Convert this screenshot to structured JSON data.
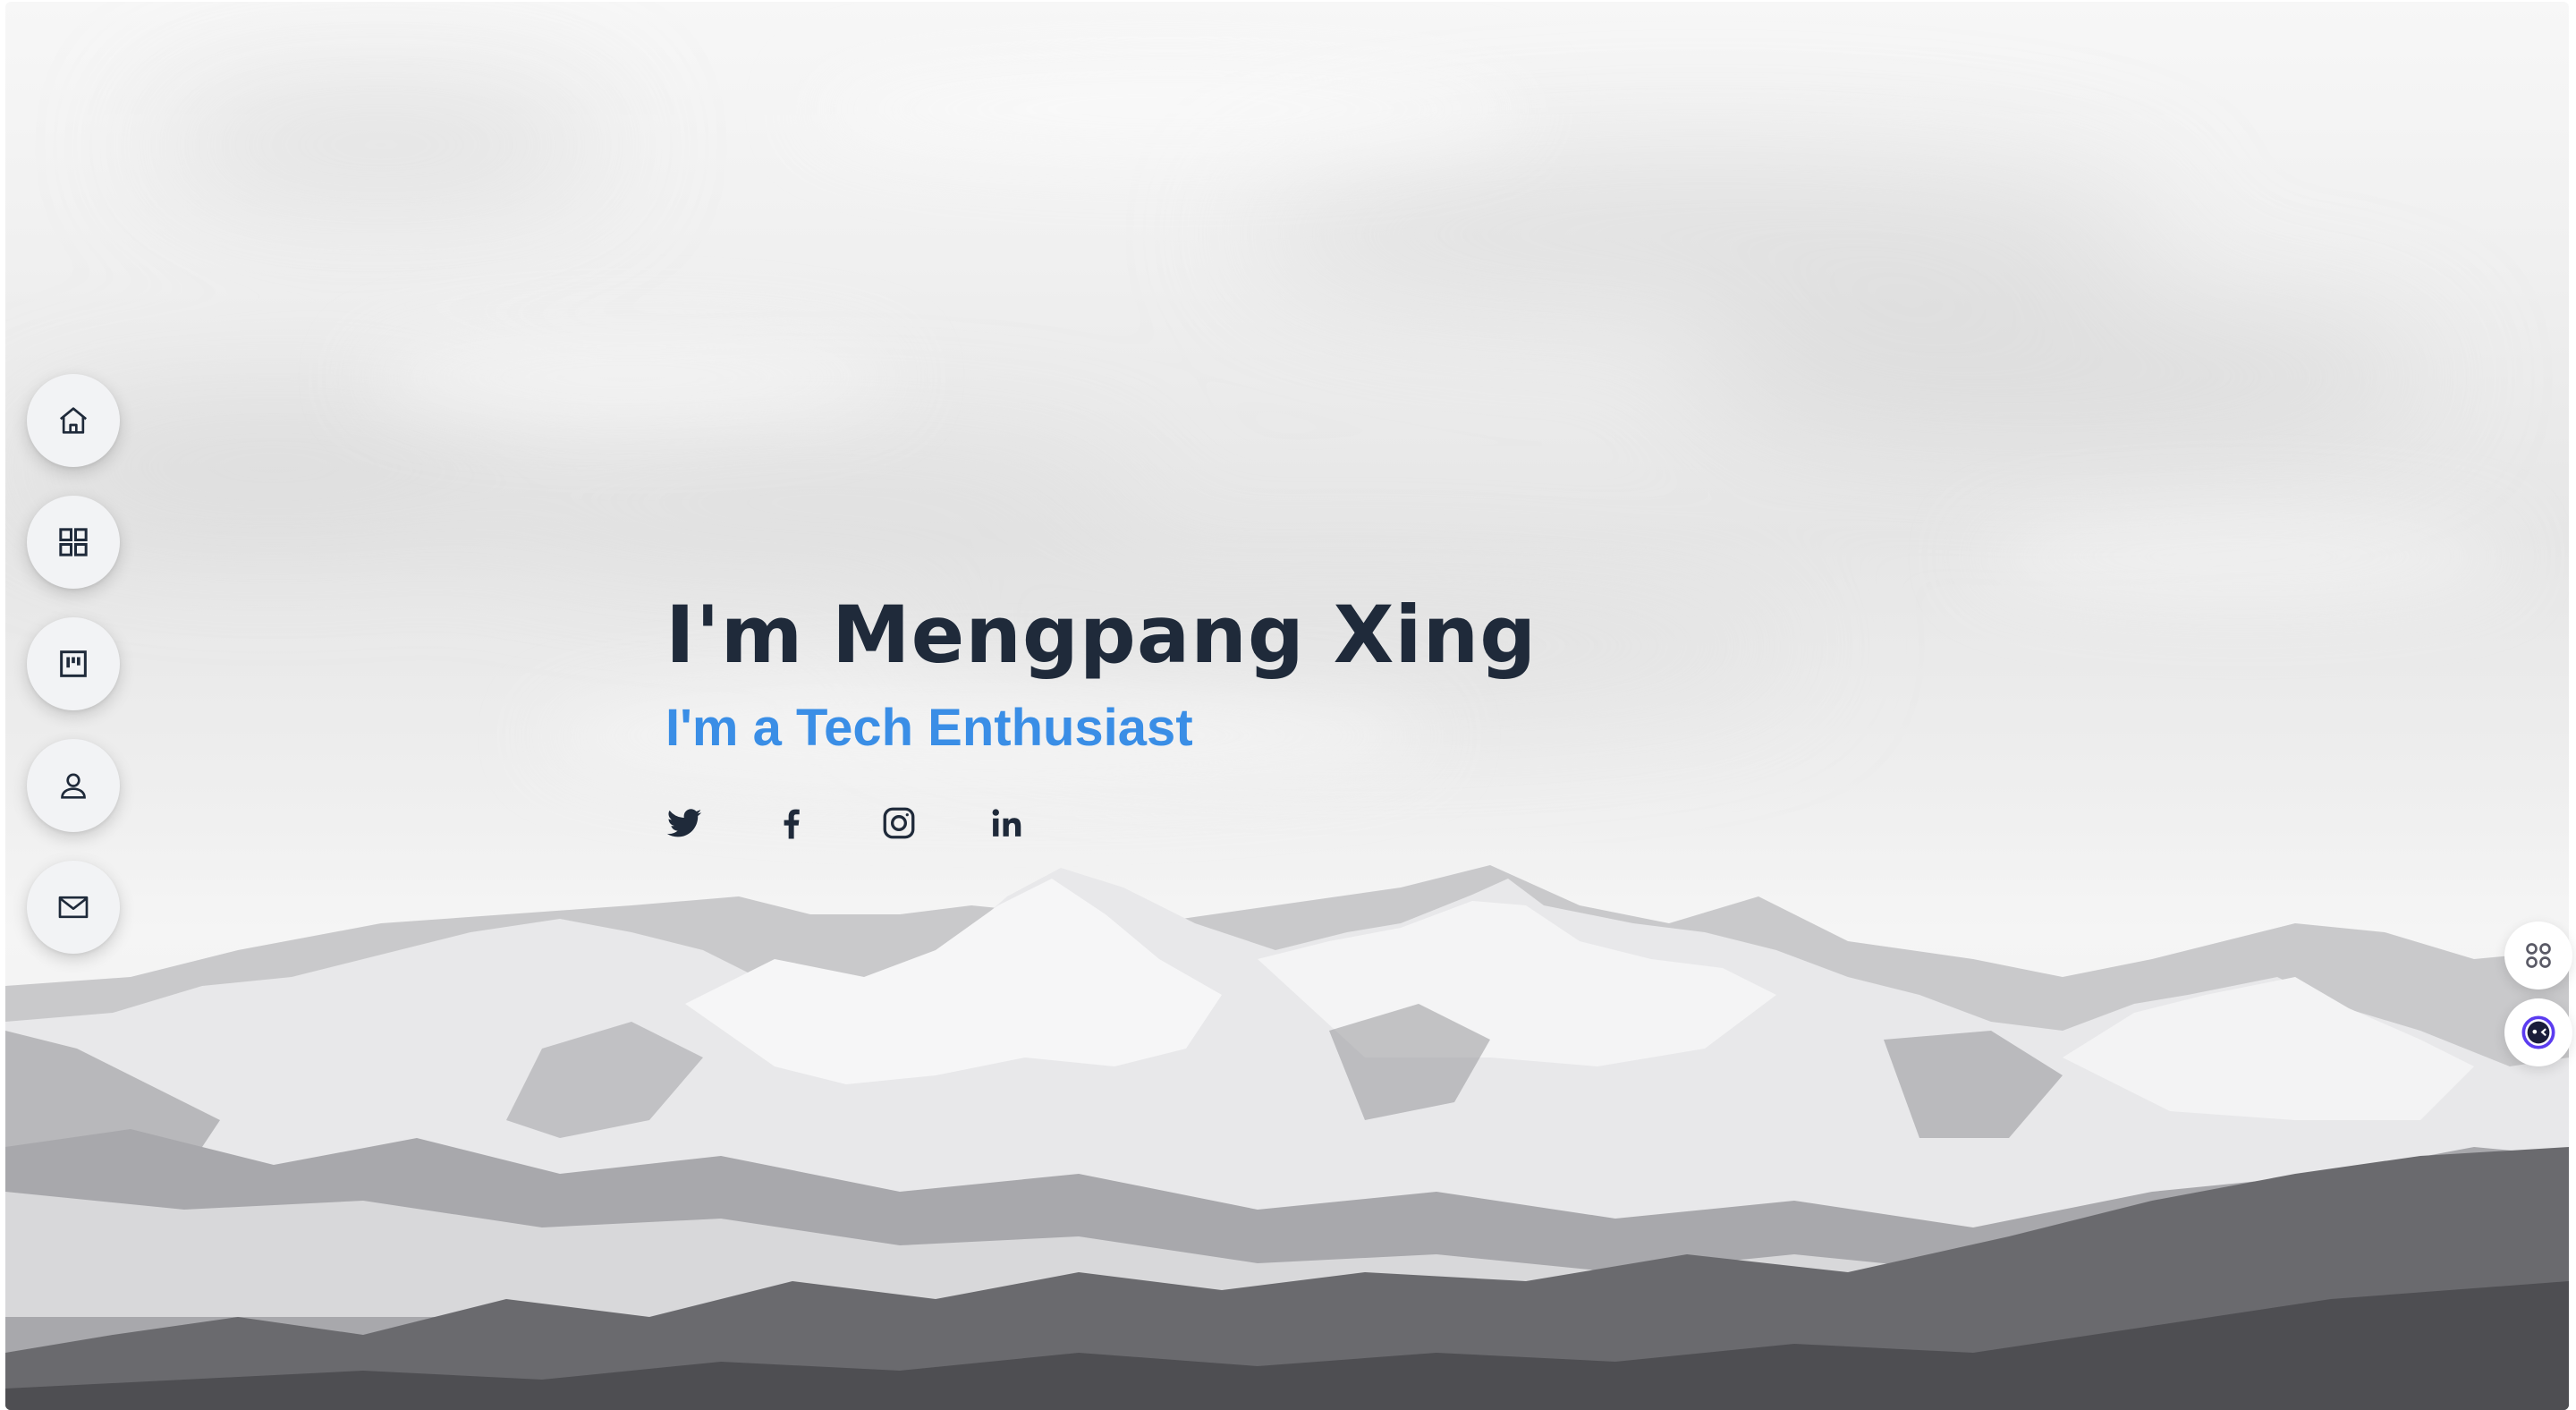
{
  "hero": {
    "title": "I'm Mengpang Xing",
    "subtitle": "I'm a Tech Enthusiast"
  },
  "nav": {
    "items": [
      {
        "icon": "home-icon",
        "label": "Home"
      },
      {
        "icon": "grid-icon",
        "label": "Portfolio"
      },
      {
        "icon": "board-icon",
        "label": "Resume"
      },
      {
        "icon": "user-icon",
        "label": "About"
      },
      {
        "icon": "mail-icon",
        "label": "Contact"
      }
    ]
  },
  "social": [
    {
      "icon": "twitter-icon",
      "name": "Twitter"
    },
    {
      "icon": "facebook-icon",
      "name": "Facebook"
    },
    {
      "icon": "instagram-icon",
      "name": "Instagram"
    },
    {
      "icon": "linkedin-icon",
      "name": "LinkedIn"
    }
  ],
  "floating": [
    {
      "icon": "apps-icon"
    },
    {
      "icon": "assistant-face-icon"
    }
  ],
  "colors": {
    "title": "#1f2a3a",
    "subtitle": "#3a8ee6",
    "nav_bg": "#f2f3f5",
    "icon": "#1f2a3a",
    "assistant_accent": "#5b3cf0"
  }
}
